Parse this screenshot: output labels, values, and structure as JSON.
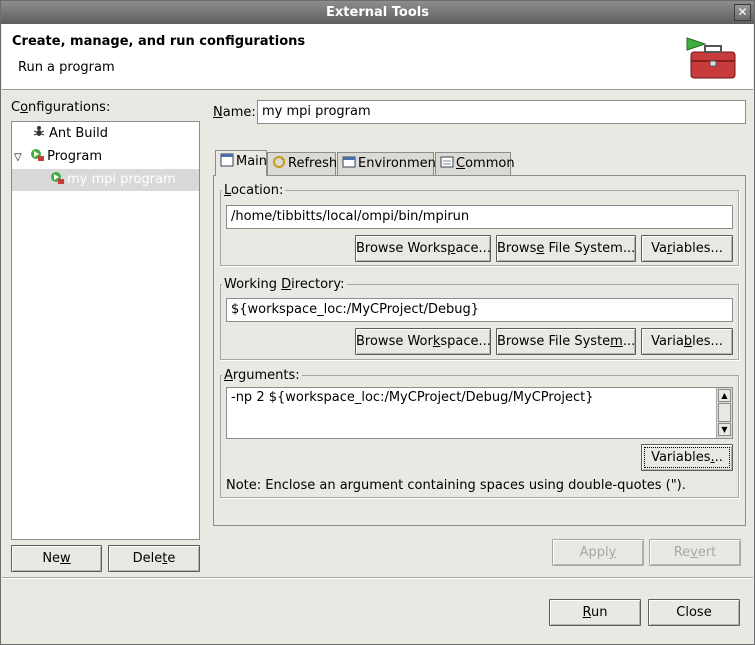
{
  "window": {
    "title": "External Tools"
  },
  "header": {
    "title": "Create, manage, and run configurations",
    "subtitle": "Run a program"
  },
  "configurations": {
    "label_pre": "C",
    "label_u": "o",
    "label_post": "nfigurations:",
    "items": [
      {
        "label": "Ant Build"
      },
      {
        "label": "Program"
      },
      {
        "label": "my mpi program"
      }
    ],
    "new": {
      "pre": "Ne",
      "u": "w",
      "post": ""
    },
    "delete": {
      "pre": "Dele",
      "u": "t",
      "post": "e"
    }
  },
  "name": {
    "label_u": "N",
    "label_post": "ame:",
    "value": "my mpi program"
  },
  "tabs": [
    {
      "label": "Main",
      "icon": "main-tab-icon"
    },
    {
      "label": "Refresh",
      "icon": "refresh-tab-icon"
    },
    {
      "label": "Environment",
      "icon": "environment-tab-icon"
    },
    {
      "pre": "",
      "u": "C",
      "post": "ommon",
      "icon": "common-tab-icon"
    }
  ],
  "location": {
    "label_u": "L",
    "label_post": "ocation:",
    "value": "/home/tibbitts/local/ompi/bin/mpirun",
    "browse_ws": {
      "pre": "Browse Works",
      "u": "p",
      "post": "ace..."
    },
    "browse_fs": {
      "pre": "Brows",
      "u": "e",
      "post": " File System..."
    },
    "variables": {
      "pre": "Va",
      "u": "r",
      "post": "iables..."
    }
  },
  "workdir": {
    "label_pre": "Working ",
    "label_u": "D",
    "label_post": "irectory:",
    "value": "${workspace_loc:/MyCProject/Debug}",
    "browse_ws": {
      "pre": "Browse Wor",
      "u": "k",
      "post": "space..."
    },
    "browse_fs": {
      "pre": "Browse File Syste",
      "u": "m",
      "post": "..."
    },
    "variables": {
      "pre": "Varia",
      "u": "b",
      "post": "les..."
    }
  },
  "arguments": {
    "label_u": "A",
    "label_post": "rguments:",
    "value": "-np 2 ${workspace_loc:/MyCProject/Debug/MyCProject}",
    "variables": {
      "pre": "Variables",
      "u": ".",
      "post": ".."
    },
    "note": "Note: Enclose an argument containing spaces using double-quotes (\")."
  },
  "footer": {
    "apply": {
      "pre": "Appl",
      "u": "y",
      "post": ""
    },
    "revert": {
      "pre": "Re",
      "u": "v",
      "post": "ert"
    },
    "run": {
      "pre": "",
      "u": "R",
      "post": "un"
    },
    "close": "Close"
  }
}
